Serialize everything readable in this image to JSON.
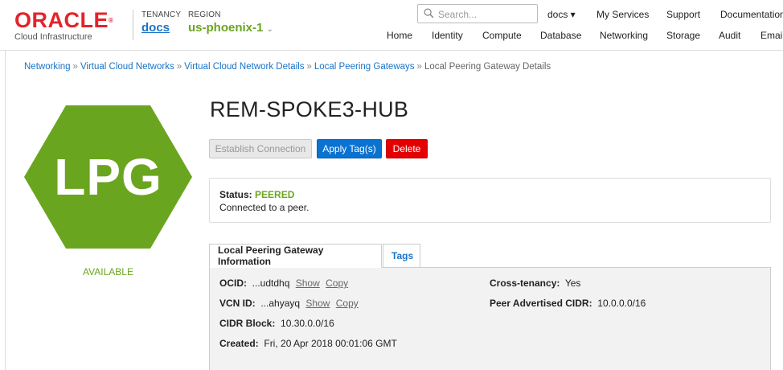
{
  "header": {
    "logo_text": "ORACLE",
    "logo_reg": "®",
    "logo_subtitle": "Cloud Infrastructure",
    "tenancy_label": "TENANCY",
    "tenancy_value": "docs",
    "region_label": "REGION",
    "region_value": "us-phoenix-1",
    "region_chevron": "⌄",
    "search_placeholder": "Search...",
    "user_menu": "docs ▾",
    "top_links": [
      "My Services",
      "Support",
      "Documentation"
    ],
    "nav": [
      "Home",
      "Identity",
      "Compute",
      "Database",
      "Networking",
      "Storage",
      "Audit",
      "Email"
    ]
  },
  "breadcrumb": {
    "items": [
      "Networking",
      "Virtual Cloud Networks",
      "Virtual Cloud Network Details",
      "Local Peering Gateways"
    ],
    "separator": "»",
    "current": "Local Peering Gateway Details"
  },
  "resource": {
    "icon_text": "LPG",
    "icon_color": "#6aa51f",
    "lifecycle_state": "AVAILABLE",
    "title": "REM-SPOKE3-HUB"
  },
  "actions": {
    "establish": "Establish Connection",
    "apply_tags": "Apply Tag(s)",
    "delete": "Delete"
  },
  "status": {
    "label": "Status:",
    "value": "PEERED",
    "message": "Connected to a peer."
  },
  "tabs": {
    "info": "Local Peering Gateway Information",
    "tags": "Tags"
  },
  "info": {
    "ocid_label": "OCID:",
    "ocid_value": "...udtdhq",
    "vcn_label": "VCN ID:",
    "vcn_value": "...ahyayq",
    "show": "Show",
    "copy": "Copy",
    "cidr_label": "CIDR Block:",
    "cidr_value": "10.30.0.0/16",
    "created_label": "Created:",
    "created_value": "Fri, 20 Apr 2018 00:01:06 GMT",
    "cross_label": "Cross-tenancy:",
    "cross_value": "Yes",
    "peer_cidr_label": "Peer Advertised CIDR:",
    "peer_cidr_value": "10.0.0.0/16"
  }
}
